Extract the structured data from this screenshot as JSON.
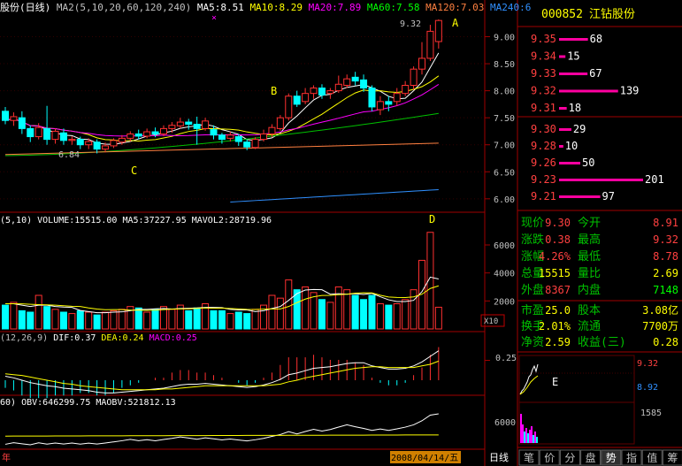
{
  "header": {
    "title": "股份(日线)",
    "ma_items": [
      {
        "label": "MA2(5,10,20,60,120,240)",
        "color": "#c0c0c0"
      },
      {
        "label": "MA5:8.51",
        "color": "#ffffff"
      },
      {
        "label": "MA10:8.29",
        "color": "#ffff00"
      },
      {
        "label": "MA20:7.89",
        "color": "#ff00ff"
      },
      {
        "label": "MA60:7.58",
        "color": "#00ff00"
      },
      {
        "label": "MA120:7.03",
        "color": "#ff8040"
      },
      {
        "label": "MA240:6",
        "color": "#3090ff"
      }
    ]
  },
  "price_panel": {
    "axis_labels": [
      "9.00",
      "8.50",
      "8.00",
      "7.50",
      "7.00",
      "6.50",
      "6.00"
    ],
    "axis_values": [
      9.0,
      8.5,
      8.0,
      7.5,
      7.0,
      6.5,
      6.0
    ],
    "high_label": "9.32",
    "low_label": "6.84",
    "annotations": [
      "A",
      "B",
      "C"
    ]
  },
  "volume_panel": {
    "title": "(5,10) VOLUME:15515.00 MA5:37227.95 MAVOL2:28719.96",
    "axis_labels": [
      "6000",
      "4000",
      "2000"
    ],
    "axis_values": [
      6000,
      4000,
      2000
    ],
    "unit": "X10",
    "annotation": "D"
  },
  "macd_panel": {
    "items": [
      {
        "label": "(12,26,9)",
        "color": "#c0c0c0"
      },
      {
        "label": "DIF:0.37",
        "color": "#ffffff"
      },
      {
        "label": "DEA:0.24",
        "color": "#ffff00"
      },
      {
        "label": "MACD:0.25",
        "color": "#ff00ff"
      }
    ],
    "axis_label": "0.25"
  },
  "obv_panel": {
    "title": "60) OBV:646299.75 MAOBV:521812.13"
  },
  "bottom_bar": {
    "date_left": "年",
    "current_date": "2008/04/14/五",
    "period_label": "日线"
  },
  "quote": {
    "code": "000852",
    "name": "江钻股份",
    "asks": [
      {
        "price": "9.35",
        "volume": "68"
      },
      {
        "price": "9.34",
        "volume": "15"
      },
      {
        "price": "9.33",
        "volume": "67"
      },
      {
        "price": "9.32",
        "volume": "139"
      },
      {
        "price": "9.31",
        "volume": "18"
      }
    ],
    "bids": [
      {
        "price": "9.30",
        "volume": "29"
      },
      {
        "price": "9.28",
        "volume": "10"
      },
      {
        "price": "9.26",
        "volume": "50"
      },
      {
        "price": "9.23",
        "volume": "201"
      },
      {
        "price": "9.21",
        "volume": "97"
      }
    ],
    "stats": [
      {
        "l1": "现价",
        "v1": "9.30",
        "c1": "#ff4040",
        "l2": "今开",
        "v2": "8.91",
        "c2": "#ff4040"
      },
      {
        "l1": "涨跌",
        "v1": "0.38",
        "c1": "#ff4040",
        "l2": "最高",
        "v2": "9.32",
        "c2": "#ff4040"
      },
      {
        "l1": "涨幅",
        "v1": "4.26%",
        "c1": "#ff4040",
        "l2": "最低",
        "v2": "8.78",
        "c2": "#ff4040"
      },
      {
        "l1": "总量",
        "v1": "15515",
        "c1": "#ffff00",
        "l2": "量比",
        "v2": "2.69",
        "c2": "#ffff00"
      },
      {
        "l1": "外盘",
        "v1": "8367",
        "c1": "#ff4040",
        "l2": "内盘",
        "v2": "7148",
        "c2": "#00ff00"
      }
    ],
    "stats2": [
      {
        "l1": "市盈",
        "v1": "25.0",
        "l2": "股本",
        "v2": "3.08亿"
      },
      {
        "l1": "换手",
        "v1": "2.01%",
        "l2": "流通",
        "v2": "7700万"
      },
      {
        "l1": "净资",
        "v1": "2.59",
        "l2": "收益(三)",
        "v2": "0.28"
      }
    ]
  },
  "mini_chart": {
    "high": "9.32",
    "low": "8.92",
    "vol_axis": "6000",
    "vol_value": "1585",
    "annotation": "E"
  },
  "tabs": [
    "笔",
    "价",
    "分",
    "盘",
    "势",
    "指",
    "值",
    "筹"
  ],
  "active_tab": "势",
  "chart_data": {
    "type": "candlestick",
    "candles": [
      {
        "o": 7.62,
        "c": 7.45,
        "h": 7.7,
        "l": 7.38
      },
      {
        "o": 7.45,
        "c": 7.52,
        "h": 7.6,
        "l": 7.35
      },
      {
        "o": 7.5,
        "c": 7.3,
        "h": 7.62,
        "l": 7.2
      },
      {
        "o": 7.3,
        "c": 7.15,
        "h": 7.36,
        "l": 7.05
      },
      {
        "o": 7.15,
        "c": 7.32,
        "h": 7.4,
        "l": 7.1
      },
      {
        "o": 7.3,
        "c": 7.1,
        "h": 7.72,
        "l": 7.0
      },
      {
        "o": 7.1,
        "c": 7.25,
        "h": 7.3,
        "l": 7.02
      },
      {
        "o": 7.22,
        "c": 7.08,
        "h": 7.3,
        "l": 7.0
      },
      {
        "o": 7.08,
        "c": 7.1,
        "h": 7.16,
        "l": 7.0
      },
      {
        "o": 7.1,
        "c": 7.0,
        "h": 7.15,
        "l": 6.92
      },
      {
        "o": 7.0,
        "c": 7.06,
        "h": 7.12,
        "l": 6.92
      },
      {
        "o": 7.05,
        "c": 6.92,
        "h": 7.1,
        "l": 6.84
      },
      {
        "o": 6.92,
        "c": 6.98,
        "h": 7.04,
        "l": 6.86
      },
      {
        "o": 6.98,
        "c": 7.08,
        "h": 7.12,
        "l": 6.94
      },
      {
        "o": 7.05,
        "c": 7.12,
        "h": 7.18,
        "l": 7.0
      },
      {
        "o": 7.12,
        "c": 7.2,
        "h": 7.25,
        "l": 7.06
      },
      {
        "o": 7.2,
        "c": 7.16,
        "h": 7.28,
        "l": 7.1
      },
      {
        "o": 7.16,
        "c": 7.24,
        "h": 7.3,
        "l": 7.12
      },
      {
        "o": 7.24,
        "c": 7.2,
        "h": 7.32,
        "l": 7.14
      },
      {
        "o": 7.2,
        "c": 7.3,
        "h": 7.36,
        "l": 7.16
      },
      {
        "o": 7.3,
        "c": 7.36,
        "h": 7.42,
        "l": 7.22
      },
      {
        "o": 7.35,
        "c": 7.42,
        "h": 7.5,
        "l": 7.3
      },
      {
        "o": 7.42,
        "c": 7.38,
        "h": 7.48,
        "l": 7.28
      },
      {
        "o": 7.38,
        "c": 7.3,
        "h": 7.52,
        "l": 7.0
      },
      {
        "o": 7.3,
        "c": 7.44,
        "h": 7.5,
        "l": 7.26
      },
      {
        "o": 7.28,
        "c": 7.18,
        "h": 7.36,
        "l": 7.1
      },
      {
        "o": 7.18,
        "c": 7.1,
        "h": 7.22,
        "l": 7.02
      },
      {
        "o": 7.12,
        "c": 7.18,
        "h": 7.24,
        "l": 7.06
      },
      {
        "o": 7.15,
        "c": 7.06,
        "h": 7.2,
        "l": 6.98
      },
      {
        "o": 7.05,
        "c": 6.96,
        "h": 7.1,
        "l": 6.9
      },
      {
        "o": 6.95,
        "c": 7.1,
        "h": 7.14,
        "l": 6.92
      },
      {
        "o": 7.1,
        "c": 7.2,
        "h": 7.28,
        "l": 7.06
      },
      {
        "o": 7.2,
        "c": 7.32,
        "h": 7.38,
        "l": 7.14
      },
      {
        "o": 7.3,
        "c": 7.5,
        "h": 7.55,
        "l": 7.26
      },
      {
        "o": 7.5,
        "c": 7.9,
        "h": 7.95,
        "l": 7.45
      },
      {
        "o": 7.9,
        "c": 7.75,
        "h": 8.0,
        "l": 7.7
      },
      {
        "o": 7.8,
        "c": 7.95,
        "h": 8.05,
        "l": 7.75
      },
      {
        "o": 7.95,
        "c": 8.05,
        "h": 8.1,
        "l": 7.85
      },
      {
        "o": 8.05,
        "c": 7.92,
        "h": 8.12,
        "l": 7.85
      },
      {
        "o": 7.95,
        "c": 8.0,
        "h": 8.05,
        "l": 7.85
      },
      {
        "o": 8.0,
        "c": 8.12,
        "h": 8.28,
        "l": 7.96
      },
      {
        "o": 8.1,
        "c": 8.22,
        "h": 8.3,
        "l": 8.05
      },
      {
        "o": 8.25,
        "c": 8.18,
        "h": 8.35,
        "l": 8.1
      },
      {
        "o": 8.2,
        "c": 8.05,
        "h": 8.3,
        "l": 7.98
      },
      {
        "o": 8.05,
        "c": 7.7,
        "h": 8.1,
        "l": 7.62
      },
      {
        "o": 7.65,
        "c": 7.8,
        "h": 7.9,
        "l": 7.55
      },
      {
        "o": 7.8,
        "c": 7.75,
        "h": 7.9,
        "l": 7.62
      },
      {
        "o": 7.8,
        "c": 7.95,
        "h": 8.05,
        "l": 7.72
      },
      {
        "o": 7.95,
        "c": 8.1,
        "h": 8.18,
        "l": 7.9
      },
      {
        "o": 8.1,
        "c": 8.4,
        "h": 8.45,
        "l": 8.02
      },
      {
        "o": 8.4,
        "c": 8.6,
        "h": 8.9,
        "l": 8.3
      },
      {
        "o": 8.6,
        "c": 9.1,
        "h": 9.22,
        "l": 8.55
      },
      {
        "o": 8.91,
        "c": 9.3,
        "h": 9.32,
        "l": 8.78
      }
    ],
    "volume_x10": [
      1700,
      1900,
      1300,
      1200,
      2400,
      1600,
      1400,
      1200,
      1100,
      1300,
      1200,
      1000,
      1200,
      1300,
      1400,
      1600,
      1500,
      1200,
      1400,
      1600,
      1400,
      1700,
      1300,
      1500,
      1800,
      1300,
      1300,
      1100,
      1200,
      1100,
      1400,
      1700,
      2400,
      2200,
      3500,
      2800,
      3000,
      2600,
      2100,
      1900,
      3000,
      2800,
      2400,
      2100,
      2400,
      1800,
      1700,
      1800,
      2100,
      2800,
      4900,
      6900,
      1551
    ],
    "volume_ma5": [
      1800,
      1800,
      1700,
      1600,
      1700,
      1700,
      1600,
      1560,
      1540,
      1320,
      1240,
      1160,
      1160,
      1200,
      1220,
      1300,
      1400,
      1400,
      1440,
      1460,
      1420,
      1460,
      1480,
      1500,
      1540,
      1540,
      1520,
      1400,
      1360,
      1360,
      1240,
      1300,
      1460,
      1600,
      2040,
      2520,
      2780,
      2820,
      2800,
      2480,
      2520,
      2480,
      2520,
      2460,
      2540,
      2300,
      2080,
      1960,
      1960,
      2040,
      2660,
      3700,
      3570
    ],
    "volume_ma10": [
      1800,
      1800,
      1790,
      1760,
      1740,
      1720,
      1700,
      1660,
      1620,
      1600,
      1500,
      1420,
      1370,
      1380,
      1380,
      1340,
      1340,
      1330,
      1340,
      1380,
      1410,
      1430,
      1440,
      1470,
      1500,
      1480,
      1490,
      1460,
      1430,
      1400,
      1390,
      1410,
      1430,
      1430,
      1600,
      1880,
      2130,
      2300,
      2390,
      2400,
      2450,
      2480,
      2560,
      2580,
      2570,
      2410,
      2280,
      2250,
      2240,
      2290,
      2480,
      2890,
      3080
    ],
    "dif": [
      0.05,
      0.03,
      0.0,
      -0.03,
      -0.05,
      -0.07,
      -0.08,
      -0.1,
      -0.11,
      -0.12,
      -0.13,
      -0.15,
      -0.16,
      -0.16,
      -0.15,
      -0.14,
      -0.13,
      -0.12,
      -0.11,
      -0.1,
      -0.08,
      -0.06,
      -0.05,
      -0.05,
      -0.04,
      -0.05,
      -0.06,
      -0.07,
      -0.08,
      -0.09,
      -0.08,
      -0.06,
      -0.03,
      0.01,
      0.07,
      0.09,
      0.12,
      0.15,
      0.16,
      0.17,
      0.19,
      0.21,
      0.22,
      0.22,
      0.18,
      0.16,
      0.14,
      0.14,
      0.15,
      0.18,
      0.23,
      0.3,
      0.37
    ],
    "dea": [
      0.08,
      0.07,
      0.06,
      0.04,
      0.02,
      0.0,
      -0.02,
      -0.04,
      -0.05,
      -0.07,
      -0.08,
      -0.09,
      -0.1,
      -0.11,
      -0.12,
      -0.12,
      -0.12,
      -0.12,
      -0.12,
      -0.11,
      -0.11,
      -0.1,
      -0.09,
      -0.08,
      -0.07,
      -0.07,
      -0.07,
      -0.07,
      -0.07,
      -0.07,
      -0.07,
      -0.07,
      -0.06,
      -0.05,
      -0.02,
      0.0,
      0.03,
      0.05,
      0.07,
      0.09,
      0.11,
      0.13,
      0.15,
      0.16,
      0.17,
      0.17,
      0.16,
      0.16,
      0.16,
      0.16,
      0.18,
      0.2,
      0.24
    ]
  }
}
